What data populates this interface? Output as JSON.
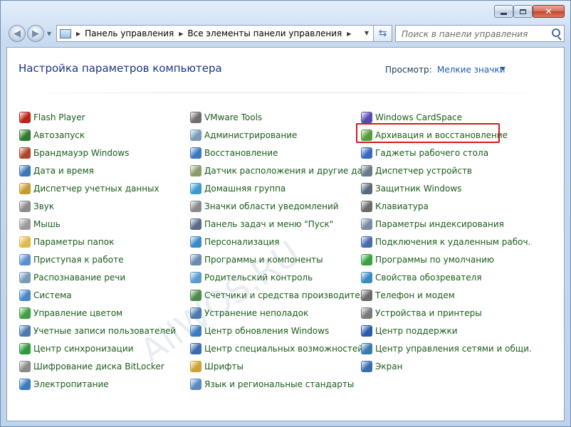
{
  "window": {
    "minimize_icon": "minimize-icon",
    "maximize_icon": "maximize-icon",
    "close_icon": "close-icon"
  },
  "nav": {
    "breadcrumbs": [
      "Панель управления",
      "Все элементы панели управления"
    ],
    "search_placeholder": "Поиск в панели управления"
  },
  "header": {
    "title": "Настройка параметров компьютера",
    "view_label": "Просмотр:",
    "view_value": "Мелкие значки"
  },
  "columns": [
    [
      {
        "label": "Flash Player",
        "icon": "flash-icon",
        "color": "#c0201a"
      },
      {
        "label": "Автозапуск",
        "icon": "autoplay-icon",
        "color": "#2f7a2f"
      },
      {
        "label": "Брандмауэр Windows",
        "icon": "firewall-icon",
        "color": "#b0452b"
      },
      {
        "label": "Дата и время",
        "icon": "clock-icon",
        "color": "#3c78b8"
      },
      {
        "label": "Диспетчер учетных данных",
        "icon": "credentials-icon",
        "color": "#c99a2e"
      },
      {
        "label": "Звук",
        "icon": "speaker-icon",
        "color": "#8a8a8a"
      },
      {
        "label": "Мышь",
        "icon": "mouse-icon",
        "color": "#9a9a9a"
      },
      {
        "label": "Параметры папок",
        "icon": "folder-icon",
        "color": "#e3b84a"
      },
      {
        "label": "Приступая к работе",
        "icon": "getting-started-icon",
        "color": "#5a8fd0"
      },
      {
        "label": "Распознавание речи",
        "icon": "microphone-icon",
        "color": "#7a9ab8"
      },
      {
        "label": "Система",
        "icon": "system-icon",
        "color": "#4a86c8"
      },
      {
        "label": "Управление цветом",
        "icon": "color-management-icon",
        "color": "#3fa040"
      },
      {
        "label": "Учетные записи пользователей",
        "icon": "users-icon",
        "color": "#4a7ab0"
      },
      {
        "label": "Центр синхронизации",
        "icon": "sync-icon",
        "color": "#2e9a3a"
      },
      {
        "label": "Шифрование диска BitLocker",
        "icon": "bitlocker-icon",
        "color": "#8a8a8a"
      },
      {
        "label": "Электропитание",
        "icon": "power-icon",
        "color": "#3a7ac0"
      }
    ],
    [
      {
        "label": "VMware Tools",
        "icon": "vmware-icon",
        "color": "#6e6e6e"
      },
      {
        "label": "Администрирование",
        "icon": "admin-tools-icon",
        "color": "#7a9ab8"
      },
      {
        "label": "Восстановление",
        "icon": "recovery-icon",
        "color": "#3a78c0"
      },
      {
        "label": "Датчик расположения и другие дат...",
        "icon": "sensor-icon",
        "color": "#8a9a6a"
      },
      {
        "label": "Домашняя группа",
        "icon": "homegroup-icon",
        "color": "#3a9ad0"
      },
      {
        "label": "Значки области уведомлений",
        "icon": "tray-icon",
        "color": "#8a8a8a"
      },
      {
        "label": "Панель задач и меню \"Пуск\"",
        "icon": "taskbar-icon",
        "color": "#5a6a8a"
      },
      {
        "label": "Персонализация",
        "icon": "personalization-icon",
        "color": "#3a8ac8"
      },
      {
        "label": "Программы и компоненты",
        "icon": "programs-icon",
        "color": "#6a8ab0"
      },
      {
        "label": "Родительский контроль",
        "icon": "parental-icon",
        "color": "#5a9ad0"
      },
      {
        "label": "Счетчики и средства производител...",
        "icon": "performance-icon",
        "color": "#4a8a4a"
      },
      {
        "label": "Устранение неполадок",
        "icon": "troubleshoot-icon",
        "color": "#4a7ab0"
      },
      {
        "label": "Центр обновления Windows",
        "icon": "update-icon",
        "color": "#3a7ac0"
      },
      {
        "label": "Центр специальных возможностей",
        "icon": "accessibility-icon",
        "color": "#3a6ab0"
      },
      {
        "label": "Шрифты",
        "icon": "fonts-icon",
        "color": "#d0a030"
      },
      {
        "label": "Язык и региональные стандарты",
        "icon": "region-icon",
        "color": "#5a8ac0"
      }
    ],
    [
      {
        "label": "Windows CardSpace",
        "icon": "cardspace-icon",
        "color": "#5a4ab0"
      },
      {
        "label": "Архивация и восстановление",
        "icon": "backup-icon",
        "color": "#5a9a3a"
      },
      {
        "label": "Гаджеты рабочего стола",
        "icon": "gadgets-icon",
        "color": "#3a6ac0"
      },
      {
        "label": "Диспетчер устройств",
        "icon": "device-manager-icon",
        "color": "#6a7a8a"
      },
      {
        "label": "Защитник Windows",
        "icon": "defender-icon",
        "color": "#5a6a7a"
      },
      {
        "label": "Клавиатура",
        "icon": "keyboard-icon",
        "color": "#6a6a6a"
      },
      {
        "label": "Параметры индексирования",
        "icon": "indexing-icon",
        "color": "#7a8aa0"
      },
      {
        "label": "Подключения к удаленным рабоч...",
        "icon": "remote-desktop-icon",
        "color": "#4a6ab0"
      },
      {
        "label": "Программы по умолчанию",
        "icon": "default-programs-icon",
        "color": "#3aa040"
      },
      {
        "label": "Свойства обозревателя",
        "icon": "internet-options-icon",
        "color": "#3a8ac0"
      },
      {
        "label": "Телефон и модем",
        "icon": "phone-icon",
        "color": "#6a6a6a"
      },
      {
        "label": "Устройства и принтеры",
        "icon": "printer-icon",
        "color": "#7a7a7a"
      },
      {
        "label": "Центр поддержки",
        "icon": "action-center-icon",
        "color": "#2a5ab0"
      },
      {
        "label": "Центр управления сетями и общи...",
        "icon": "network-icon",
        "color": "#3a7ab0"
      },
      {
        "label": "Экран",
        "icon": "display-icon",
        "color": "#3a6ab0"
      }
    ]
  ],
  "highlight_color": "#d9191e",
  "watermark": "AllWOS.RU"
}
